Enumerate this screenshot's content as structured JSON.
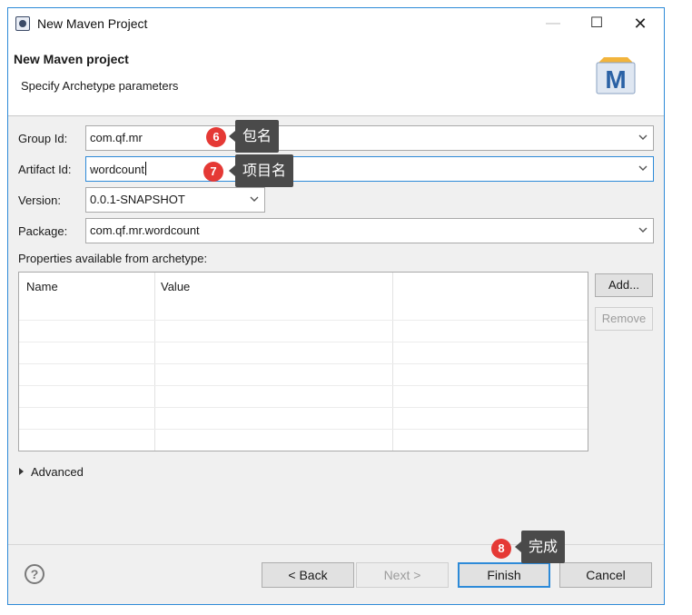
{
  "window": {
    "title": "New Maven Project",
    "controls": {
      "minimize": "—",
      "maximize": "☐",
      "close": "✕"
    }
  },
  "banner": {
    "title": "New Maven project",
    "subtitle": "Specify Archetype parameters",
    "logo_letter": "M"
  },
  "form": {
    "group_id": {
      "label": "Group Id:",
      "value": "com.qf.mr"
    },
    "artifact_id": {
      "label": "Artifact Id:",
      "value": "wordcount"
    },
    "version": {
      "label": "Version:",
      "value": "0.0.1-SNAPSHOT"
    },
    "package": {
      "label": "Package:",
      "value": "com.qf.mr.wordcount"
    }
  },
  "properties": {
    "label": "Properties available from archetype:",
    "columns": [
      "Name",
      "Value"
    ],
    "add_button": "Add...",
    "remove_button": "Remove"
  },
  "advanced_label": "Advanced",
  "footer": {
    "help": "?",
    "back": "< Back",
    "next": "Next >",
    "finish": "Finish",
    "cancel": "Cancel"
  },
  "annotations": [
    {
      "number": "6",
      "text": "包名"
    },
    {
      "number": "7",
      "text": "项目名"
    },
    {
      "number": "8",
      "text": "完成"
    }
  ],
  "colors": {
    "accent": "#2d8ad8",
    "badge": "#e53935",
    "callout_bg": "#4a4a4a",
    "window_bg": "#f0f0f0"
  },
  "icons": [
    "app-icon",
    "minimize-icon",
    "maximize-icon",
    "close-icon",
    "maven-logo",
    "dropdown-icon",
    "expand-triangle-icon",
    "help-icon"
  ]
}
